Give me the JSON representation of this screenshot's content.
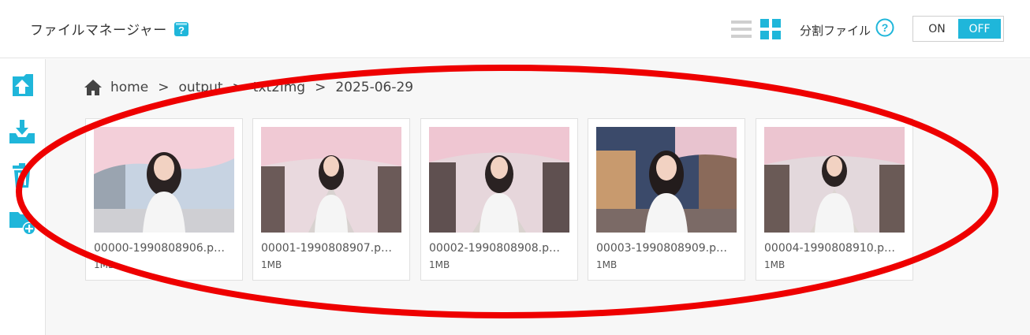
{
  "header": {
    "title": "ファイルマネージャー",
    "split_label": "分割ファイル",
    "toggle_on": "ON",
    "toggle_off": "OFF"
  },
  "colors": {
    "accent": "#1fb6da",
    "annotation": "#ee0000"
  },
  "sidebar": {
    "items": [
      {
        "name": "upload-icon"
      },
      {
        "name": "download-icon"
      },
      {
        "name": "trash-icon"
      },
      {
        "name": "new-folder-icon"
      }
    ]
  },
  "breadcrumb": {
    "home": "home",
    "sep": ">",
    "path": [
      "output",
      "txt2img",
      "2025-06-29"
    ]
  },
  "files": [
    {
      "name": "00000-1990808906.p…",
      "size": "1MB"
    },
    {
      "name": "00001-1990808907.p…",
      "size": "1MB"
    },
    {
      "name": "00002-1990808908.p…",
      "size": "1MB"
    },
    {
      "name": "00003-1990808909.p…",
      "size": "1MB"
    },
    {
      "name": "00004-1990808910.p…",
      "size": "1MB"
    }
  ]
}
